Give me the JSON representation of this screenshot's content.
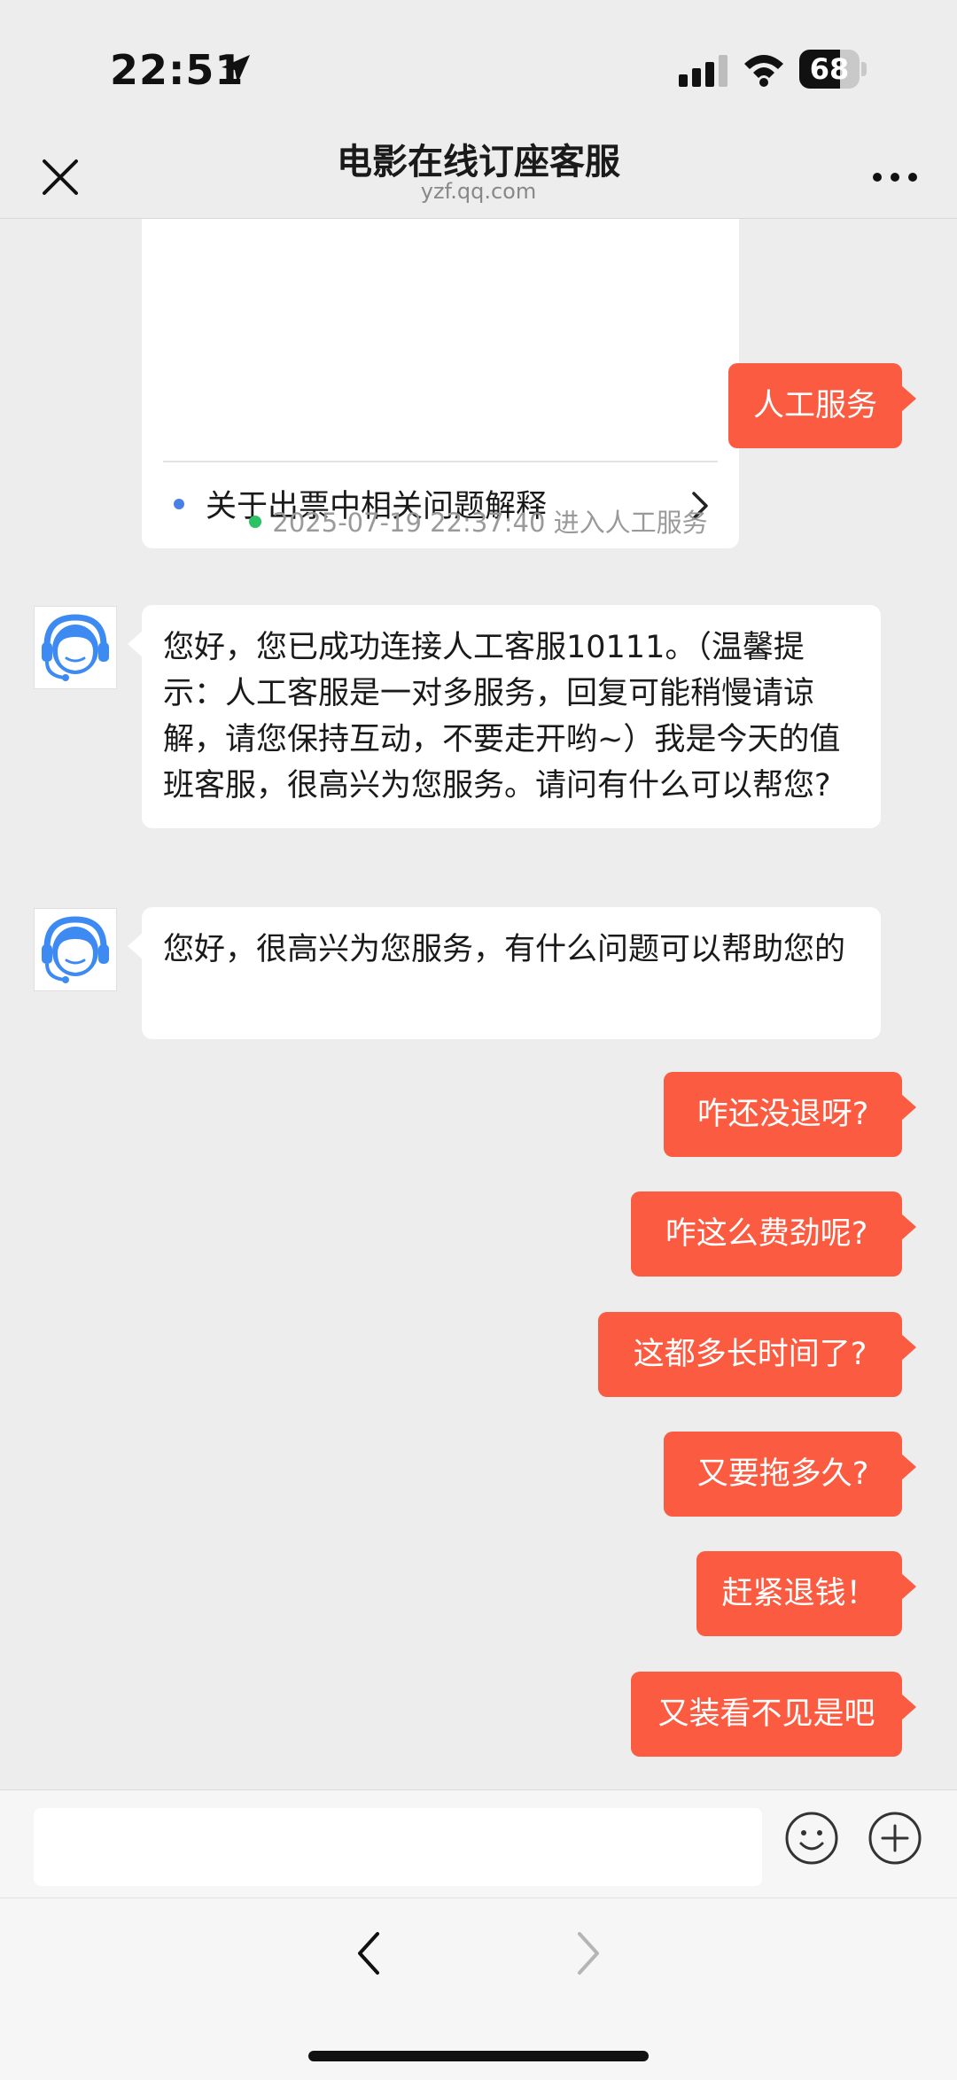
{
  "status_bar": {
    "time": "22:51",
    "battery_percent": "68",
    "battery_level": 0.68
  },
  "header": {
    "title": "电影在线订座客服",
    "subtitle": "yzf.qq.com"
  },
  "menu_card": {
    "item_label": "关于出票中相关问题解释"
  },
  "messages": {
    "user_request": "人工服务",
    "system_time": "2025-07-19 22:37:40 进入人工服务",
    "agent_1": "您好，您已成功连接人工客服10111。（温馨提示：人工客服是一对多服务，回复可能稍慢请谅解，请您保持互动，不要走开哟~）我是今天的值班客服，很高兴为您服务。请问有什么可以帮您?",
    "agent_2": "您好，很高兴为您服务，有什么问题可以帮助您的",
    "user_1": "咋还没退呀?",
    "user_2": "咋这么费劲呢?",
    "user_3": "这都多长时间了?",
    "user_4": "又要拖多久?",
    "user_5": "赶紧退钱！",
    "user_6": "又装看不见是吧"
  },
  "colors": {
    "user_bubble": "#FB5B40",
    "agent_bubble": "#FFFFFF",
    "background": "#EDEDED",
    "system_dot": "#2BC264",
    "avatar_blue": "#3D8BF2"
  }
}
